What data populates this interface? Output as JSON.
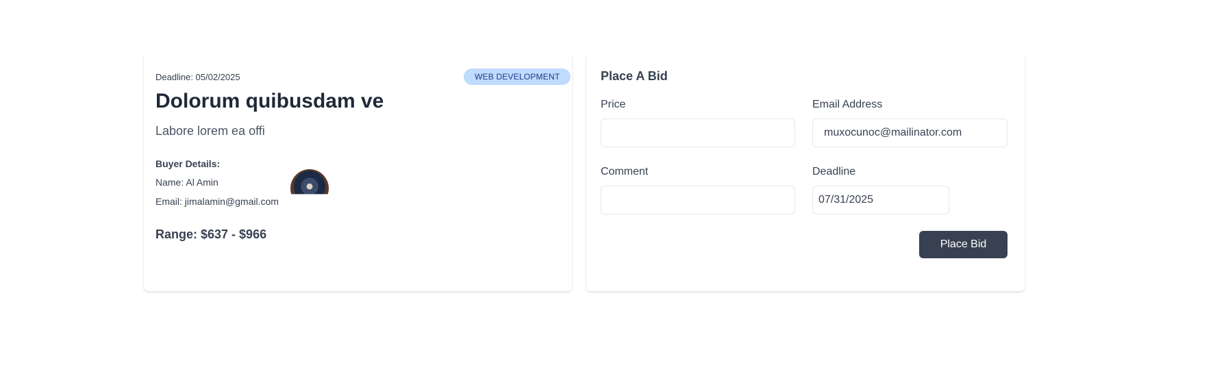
{
  "job": {
    "deadline": "Deadline: 05/02/2025",
    "category": "WEB DEVELOPMENT",
    "title": "Dolorum quibusdam ve",
    "description": "Labore lorem ea offi",
    "buyer": {
      "heading": "Buyer Details:",
      "name": "Name: Al Amin",
      "email": "Email: jimalamin@gmail.com"
    },
    "range": "Range: $637 - $966"
  },
  "bid_form": {
    "heading": "Place A Bid",
    "price_label": "Price",
    "price_value": "",
    "email_label": "Email Address",
    "email_value": "muxocunoc@mailinator.com",
    "comment_label": "Comment",
    "comment_value": "",
    "deadline_label": "Deadline",
    "deadline_value": "07/31/2025",
    "submit_label": "Place Bid"
  },
  "colors": {
    "badge_bg": "#bfdbfe",
    "badge_text": "#1e3a8a",
    "button_bg": "#374151"
  }
}
